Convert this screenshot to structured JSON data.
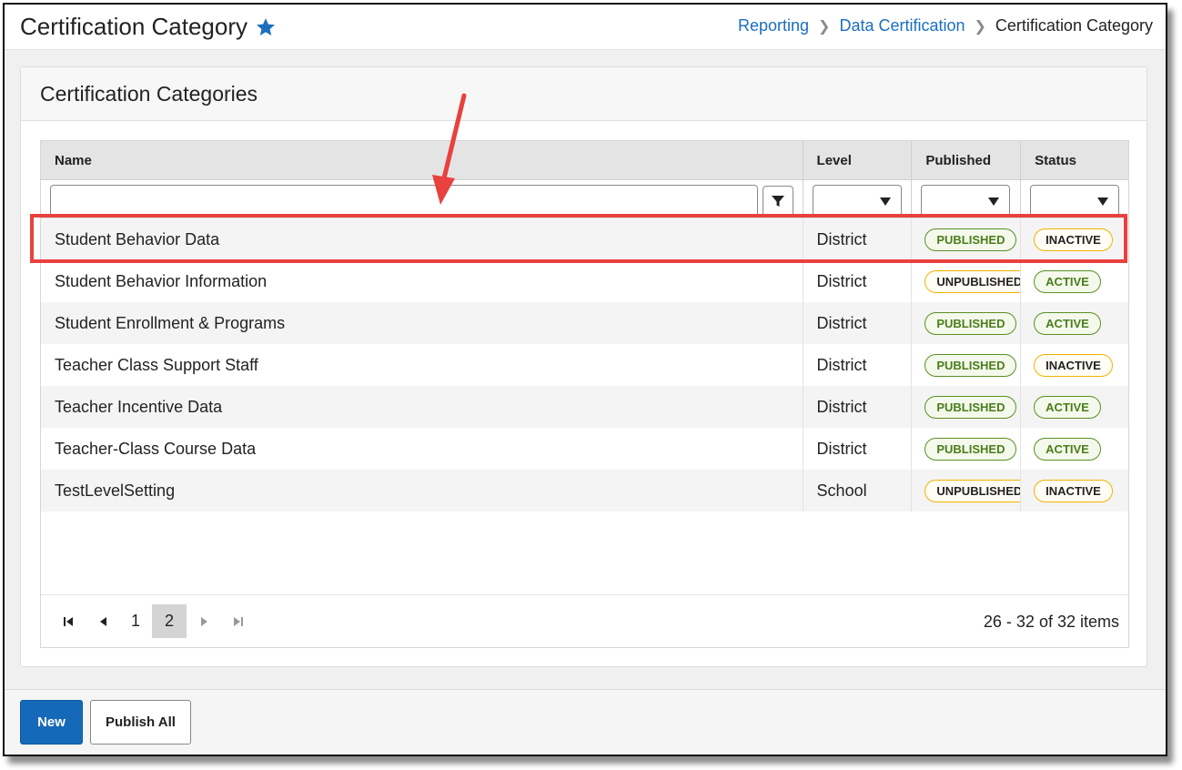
{
  "header": {
    "title": "Certification Category",
    "breadcrumb": [
      "Reporting",
      "Data Certification",
      "Certification Category"
    ]
  },
  "panel": {
    "title": "Certification Categories"
  },
  "grid": {
    "columns": [
      "Name",
      "Level",
      "Published",
      "Status"
    ],
    "rows": [
      {
        "name": "Student Behavior Data",
        "level": "District",
        "published": "PUBLISHED",
        "status": "INACTIVE"
      },
      {
        "name": "Student Behavior Information",
        "level": "District",
        "published": "UNPUBLISHED",
        "status": "ACTIVE"
      },
      {
        "name": "Student Enrollment & Programs",
        "level": "District",
        "published": "PUBLISHED",
        "status": "ACTIVE"
      },
      {
        "name": "Teacher Class Support Staff",
        "level": "District",
        "published": "PUBLISHED",
        "status": "INACTIVE"
      },
      {
        "name": "Teacher Incentive Data",
        "level": "District",
        "published": "PUBLISHED",
        "status": "ACTIVE"
      },
      {
        "name": "Teacher-Class Course Data",
        "level": "District",
        "published": "PUBLISHED",
        "status": "ACTIVE"
      },
      {
        "name": "TestLevelSetting",
        "level": "School",
        "published": "UNPUBLISHED",
        "status": "INACTIVE"
      }
    ]
  },
  "pager": {
    "pages": [
      "1",
      "2"
    ],
    "current_page": "2",
    "items_text": "26 - 32 of 32 items"
  },
  "footer": {
    "new_label": "New",
    "publish_all_label": "Publish All"
  },
  "colors": {
    "accent": "#1569b8",
    "link": "#1a6fbf",
    "highlight": "#e8413e",
    "badge_green": "#4b7d1a",
    "badge_amber": "#f0b400"
  }
}
